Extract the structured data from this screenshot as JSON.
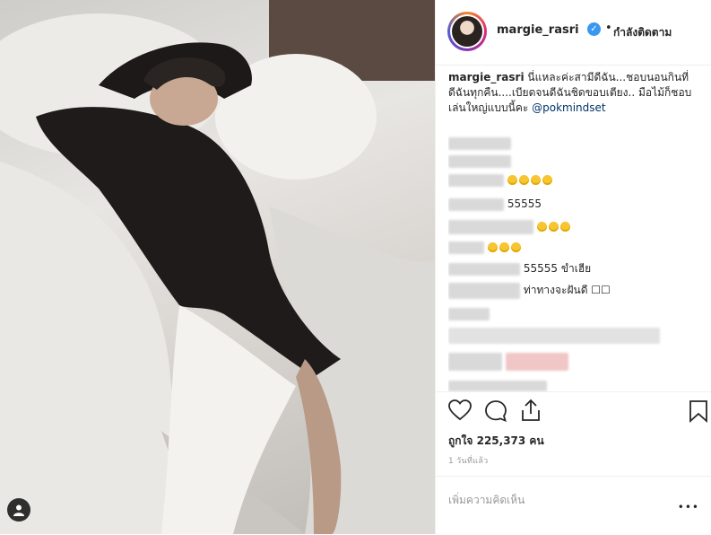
{
  "header": {
    "username": "margie_rasri",
    "dot": "•",
    "follow_label": "กำลังติดตาม"
  },
  "caption": {
    "username": "margie_rasri",
    "text": "นี่แหละค่ะสามีดีฉัน...ชอบนอนกินที่ดีฉันทุกคืน....เบียดจนดีฉันชิดขอบเตียง.. มือไม้ก็ชอบเล่นใหญ่แบบนี้คะ",
    "mention": "@pokmindset"
  },
  "comments": [
    {
      "text": ""
    },
    {
      "text": ""
    },
    {
      "text": "55555"
    },
    {
      "text": ""
    },
    {
      "text": ""
    },
    {
      "text": "55555 ขำเฮีย"
    },
    {
      "text": "ท่าทางจะฝันดี ☐☐"
    },
    {
      "text": ""
    },
    {
      "text": "ไอ้เย็นผ้าห่มเป็นมายาจ"
    }
  ],
  "actions": {
    "likes_label": "ถูกใจ 225,373 คน",
    "time_label": "1 วันที่แล้ว"
  },
  "add_comment": {
    "placeholder": "เพิ่มความคิดเห็น",
    "more": "•••"
  },
  "colors": {
    "accent": "#3897f0",
    "mention": "#003569",
    "border": "#efefef"
  },
  "icons": [
    "heart-icon",
    "comment-icon",
    "share-icon",
    "bookmark-icon",
    "user-tag-icon",
    "verified-badge-icon"
  ]
}
